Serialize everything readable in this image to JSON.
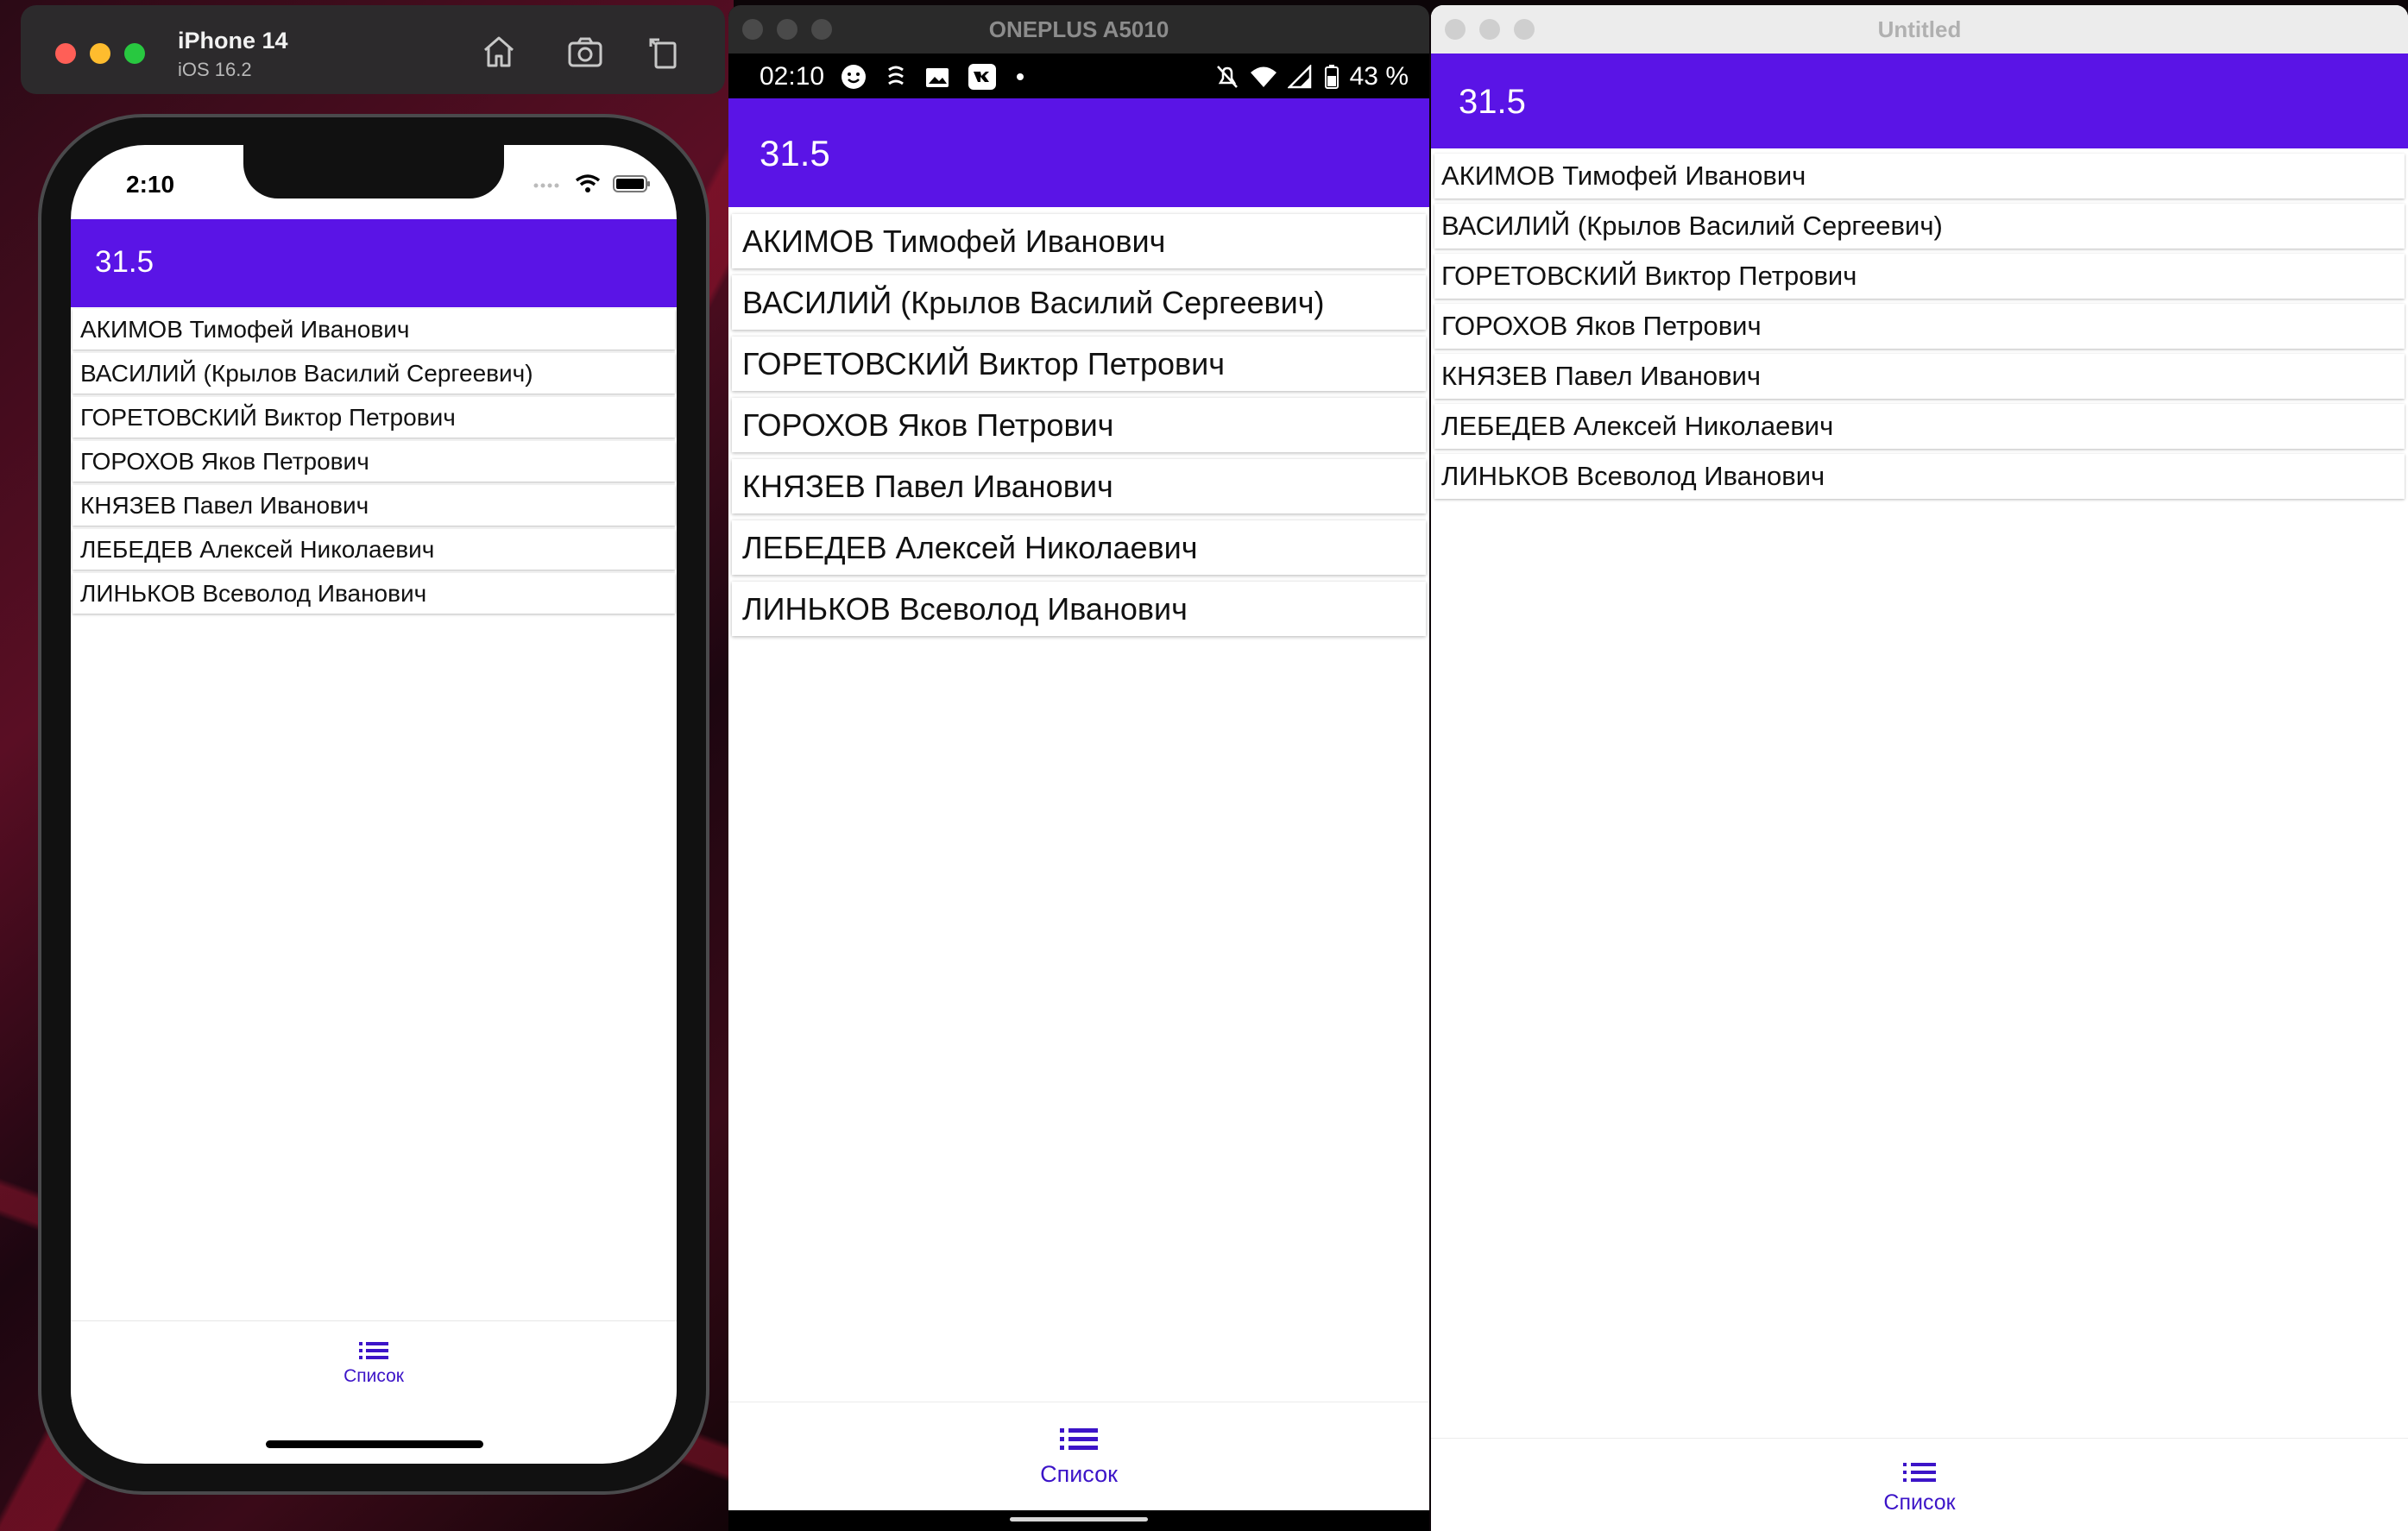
{
  "simulator": {
    "device_name": "iPhone 14",
    "os_version": "iOS 16.2",
    "toolbar_icons": [
      "home-icon",
      "screenshot-icon",
      "rotate-icon"
    ]
  },
  "ios_app": {
    "status_time": "2:10",
    "appbar_title": "31.5",
    "tab_label": "Список"
  },
  "android_window": {
    "title": "ONEPLUS A5010",
    "status_time": "02:10",
    "battery": "43 %",
    "appbar_title": "31.5",
    "tab_label": "Список"
  },
  "mac_window": {
    "title": "Untitled",
    "appbar_title": "31.5",
    "tab_label": "Список"
  },
  "list_items": [
    "АКИМОВ Тимофей Иванович",
    "ВАСИЛИЙ (Крылов Василий Сергеевич)",
    "ГОРЕТОВСКИЙ Виктор Петрович",
    "ГОРОХОВ Яков Петрович",
    "КНЯЗЕВ Павел Иванович",
    "ЛЕБЕДЕВ Алексей Николаевич",
    "ЛИНЬКОВ Всеволод Иванович"
  ],
  "colors": {
    "appbar": "#5a14e6",
    "tab_accent": "#3c14c8"
  }
}
